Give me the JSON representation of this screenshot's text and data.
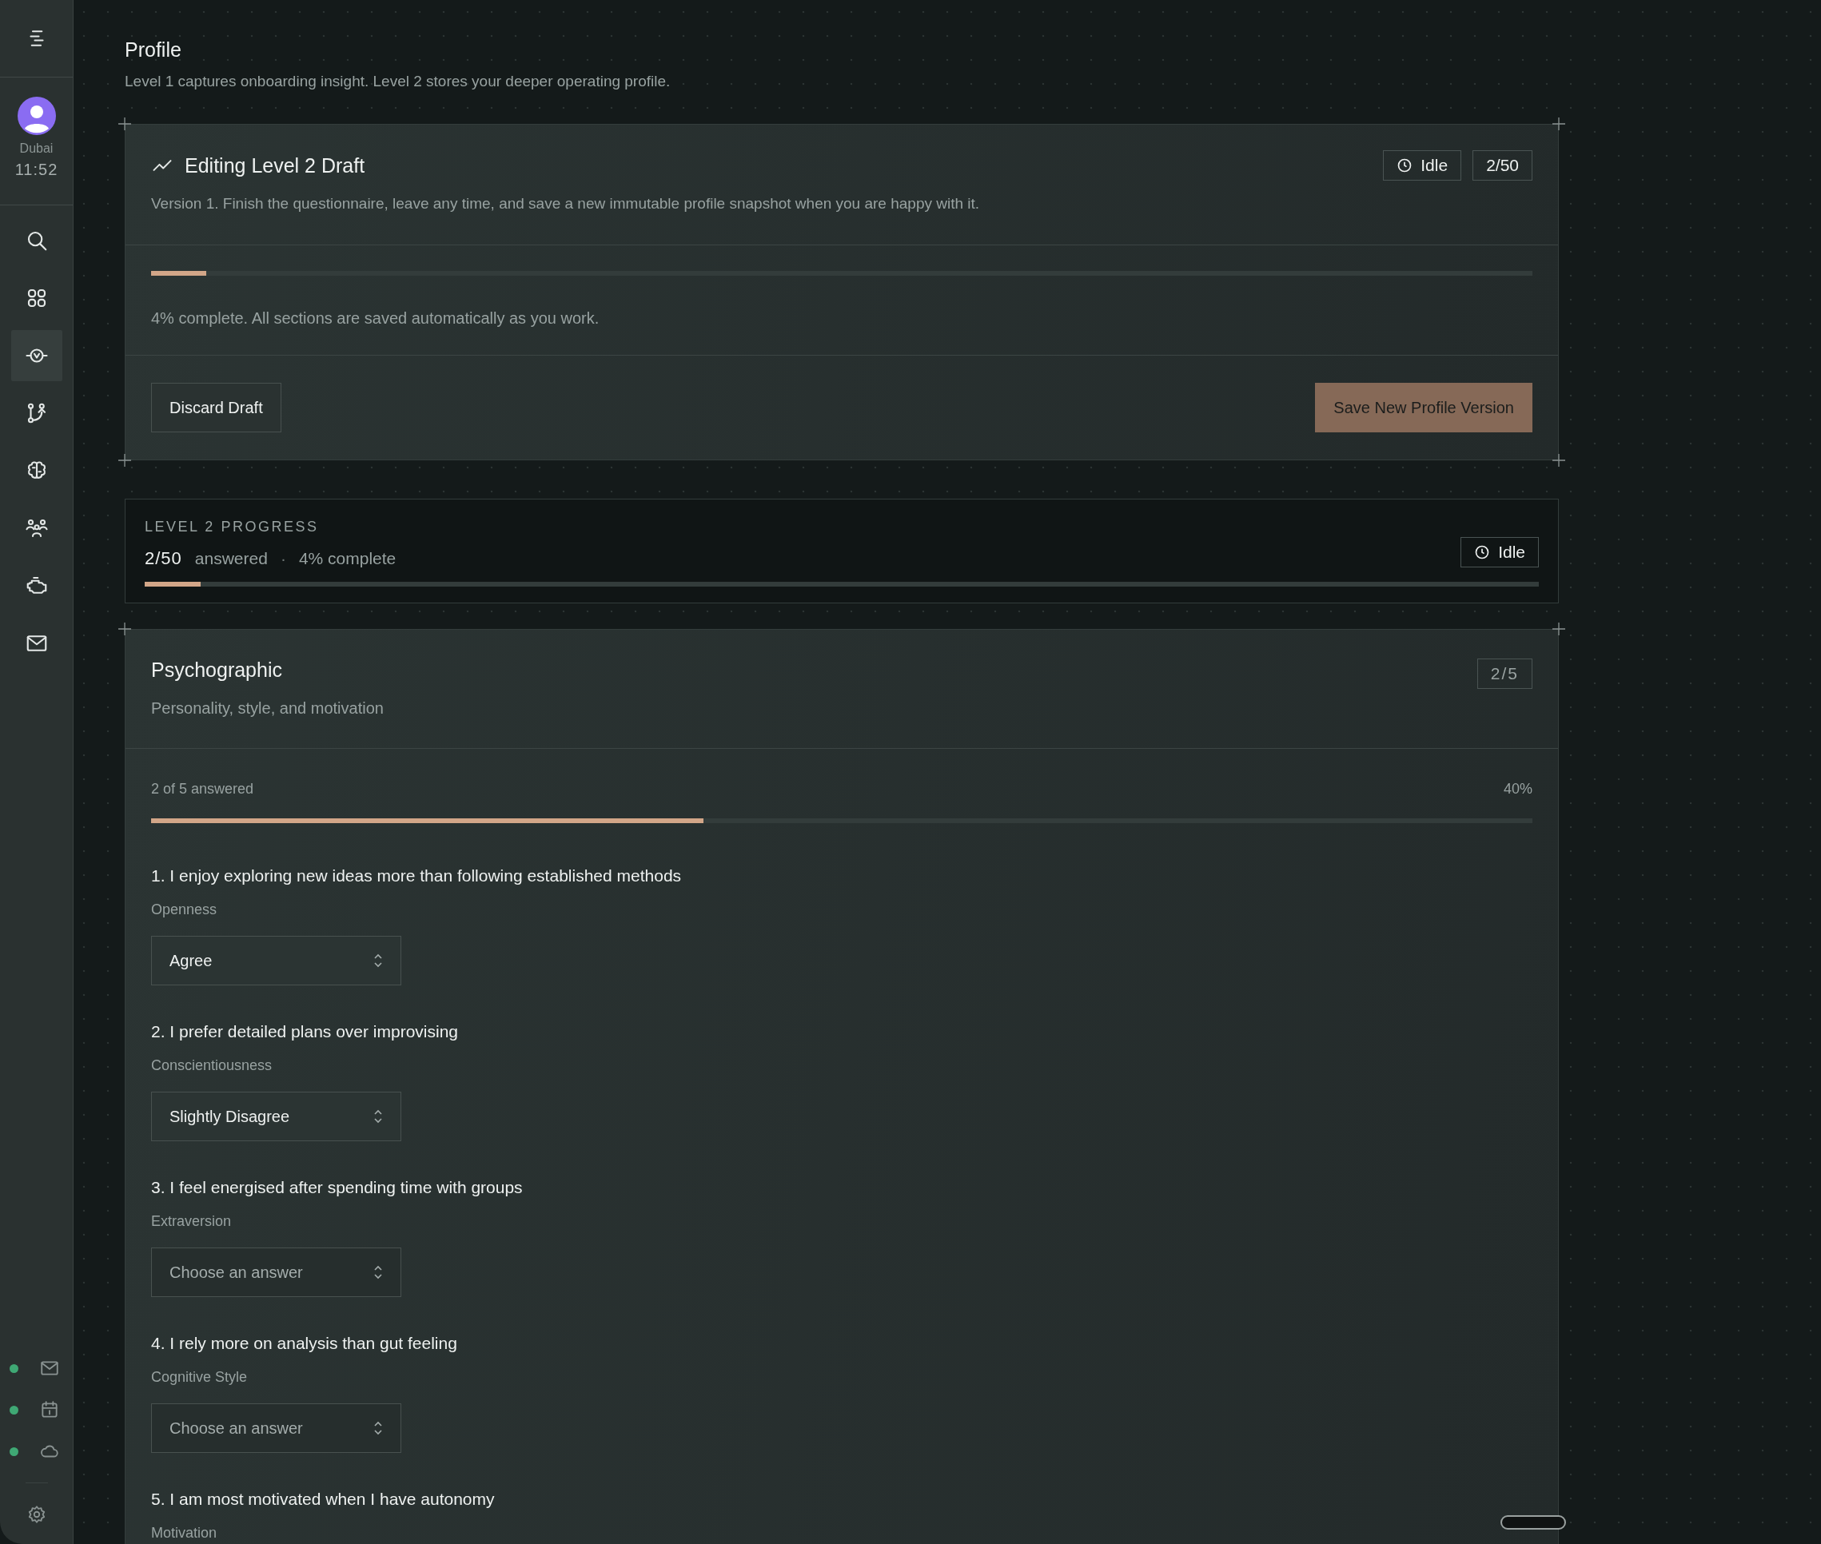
{
  "sidebar": {
    "location": "Dubai",
    "time": "11:52",
    "nav": [
      {
        "kind": "search",
        "selected": false
      },
      {
        "kind": "grid",
        "selected": false
      },
      {
        "kind": "pulse",
        "selected": true
      },
      {
        "kind": "branch",
        "selected": false
      },
      {
        "kind": "brain",
        "selected": false
      },
      {
        "kind": "people",
        "selected": false
      },
      {
        "kind": "engine",
        "selected": false
      },
      {
        "kind": "mail",
        "selected": false
      }
    ],
    "services": [
      {
        "kind": "mail",
        "connected": true
      },
      {
        "kind": "calendar",
        "connected": true
      },
      {
        "kind": "cloud",
        "connected": true
      }
    ]
  },
  "page": {
    "title": "Profile",
    "subtitle": "Level 1 captures onboarding insight. Level 2 stores your deeper operating profile."
  },
  "draft": {
    "title": "Editing Level 2 Draft",
    "status": "Idle",
    "count": "2/50",
    "description": "Version 1. Finish the questionnaire, leave any time, and save a new immutable profile snapshot when you are happy with it.",
    "level": 0.04,
    "progress_text": "4% complete. All sections are saved automatically as you work.",
    "discard_button": "Discard Draft",
    "save_button": "Save New Profile Version"
  },
  "level_progress": {
    "heading": "LEVEL 2 PROGRESS",
    "answered": "2/50",
    "answered_label": "answered",
    "separator": "·",
    "complete": "4% complete",
    "status": "Idle",
    "level": 0.04
  },
  "section": {
    "title": "Psychographic",
    "subtitle": "Personality, style, and motivation",
    "count": "2/5",
    "answered_text": "2 of 5 answered",
    "percent": "40%",
    "level": 0.4,
    "questions": [
      {
        "text": "1. I enjoy exploring new ideas more than following established methods",
        "trait": "Openness",
        "value": "Agree"
      },
      {
        "text": "2. I prefer detailed plans over improvising",
        "trait": "Conscientiousness",
        "value": "Slightly Disagree"
      },
      {
        "text": "3. I feel energised after spending time with groups",
        "trait": "Extraversion",
        "placeholder": "Choose an answer"
      },
      {
        "text": "4. I rely more on analysis than gut feeling",
        "trait": "Cognitive Style",
        "placeholder": "Choose an answer"
      },
      {
        "text": "5. I am most motivated when I have autonomy",
        "trait": "Motivation"
      }
    ]
  }
}
